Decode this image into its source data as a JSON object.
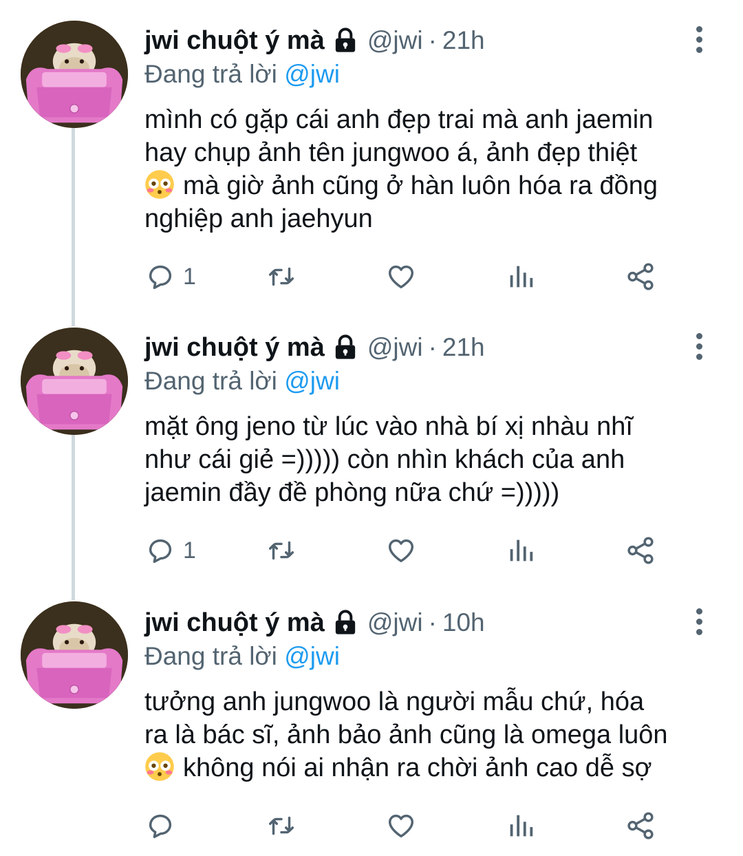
{
  "tweets": [
    {
      "author_name": "jwi chuột ý mà",
      "handle": "@jwi",
      "separator": "·",
      "time": "21h",
      "replying_prefix": "Đang trả lời",
      "replying_to": "@jwi",
      "lines": [
        "mình có gặp cái anh đẹp trai mà anh jaemin",
        "hay chụp ảnh tên jungwoo á, ảnh đẹp thiệt",
        "mà giờ ảnh cũng ở hàn luôn hóa ra đồng",
        "nghiệp anh jaehyun"
      ],
      "emoji_line": 2,
      "emoji": "flushed-face",
      "reply_count": "1",
      "icons": {
        "reply": "reply-icon",
        "retweet": "retweet-icon",
        "like": "heart-icon",
        "views": "views-chart-icon",
        "share": "share-icon",
        "more": "more-vertical-icon",
        "lock": "lock-icon"
      }
    },
    {
      "author_name": "jwi chuột ý mà",
      "handle": "@jwi",
      "separator": "·",
      "time": "21h",
      "replying_prefix": "Đang trả lời",
      "replying_to": "@jwi",
      "lines": [
        "mặt ông jeno từ lúc vào nhà bí xị nhàu nhĩ",
        "như cái giẻ =))))) còn nhìn khách của anh",
        "jaemin đầy đề phòng nữa chứ =)))))"
      ],
      "reply_count": "1"
    },
    {
      "author_name": "jwi chuột ý mà",
      "handle": "@jwi",
      "separator": "·",
      "time": "10h",
      "replying_prefix": "Đang trả lời",
      "replying_to": "@jwi",
      "lines": [
        "tưởng anh jungwoo là người mẫu chứ, hóa",
        "ra là bác sĩ, ảnh bảo ảnh cũng là omega luôn",
        "không nói ai nhận ra chời ảnh cao dễ sợ"
      ],
      "emoji_line": 2,
      "emoji": "flushed-face",
      "reply_count": ""
    }
  ],
  "colors": {
    "text": "#0f1419",
    "secondary": "#536471",
    "link": "#1d9bf0",
    "thread_line": "#cfd9de"
  }
}
